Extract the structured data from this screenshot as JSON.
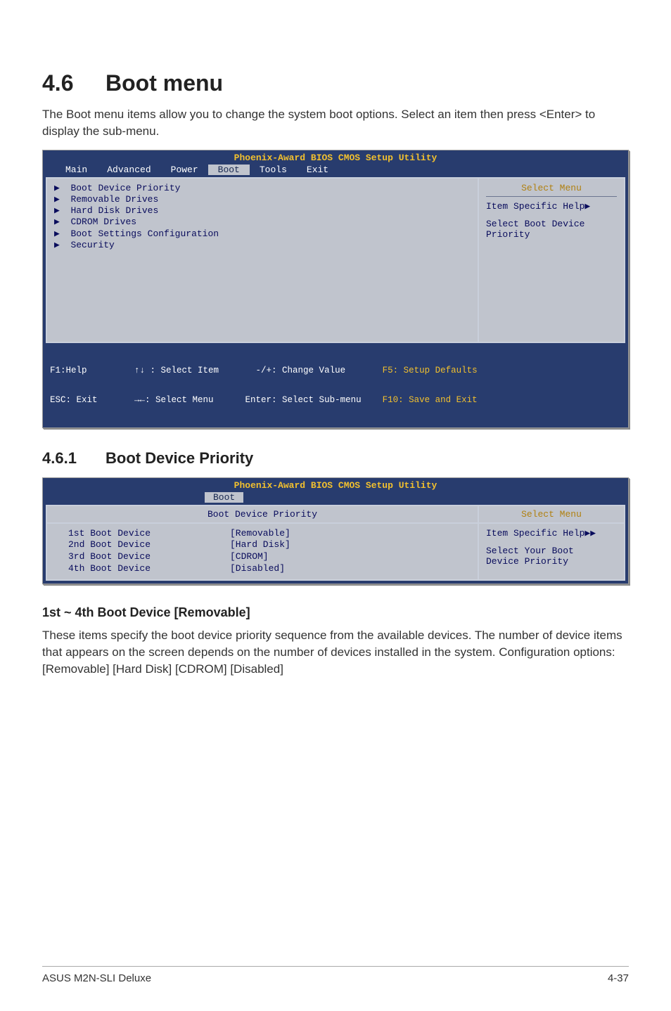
{
  "section": {
    "number": "4.6",
    "title": "Boot menu",
    "intro": "The Boot menu items allow you to change the system boot options. Select an item then press <Enter> to display the sub-menu."
  },
  "bios1": {
    "utility_title": "Phoenix-Award BIOS CMOS Setup Utility",
    "menus": {
      "main": "Main",
      "advanced": "Advanced",
      "power": "Power",
      "boot": "Boot",
      "tools": "Tools",
      "exit": "Exit"
    },
    "items": {
      "i1": "Boot Device Priority",
      "i2": "Removable Drives",
      "i3": "Hard Disk Drives",
      "i4": "CDROM Drives",
      "i5": "Boot Settings Configuration",
      "i6": "Security"
    },
    "help": {
      "select_menu": "Select Menu",
      "item_specific": "Item Specific Help▶",
      "desc1": "Select Boot Device",
      "desc2": "Priority"
    },
    "footer": {
      "f1": "F1:Help         ↑↓ : Select Item       -/+: Change Value",
      "f1r": "    F5: Setup Defaults",
      "esc": "ESC: Exit       →←: Select Menu      Enter: Select Sub-menu",
      "escr": "    F10: Save and Exit"
    }
  },
  "subsection": {
    "number": "4.6.1",
    "title": "Boot Device Priority"
  },
  "bios2": {
    "utility_title": "Phoenix-Award BIOS CMOS Setup Utility",
    "boot_tab": "Boot",
    "sub_title": "Boot Device Priority",
    "select_menu": "Select Menu",
    "rows": {
      "r1": {
        "label": "1st Boot Device",
        "value": "[Removable]"
      },
      "r2": {
        "label": "2nd Boot Device",
        "value": "[Hard Disk]"
      },
      "r3": {
        "label": "3rd Boot Device",
        "value": "[CDROM]"
      },
      "r4": {
        "label": "4th Boot Device",
        "value": "[Disabled]"
      }
    },
    "help": {
      "item_specific": "Item Specific Help▶▶",
      "desc1": "Select Your Boot",
      "desc2": "Device Priority"
    }
  },
  "setting": {
    "heading": "1st ~ 4th Boot Device [Removable]",
    "paragraph": "These items specify the boot device priority sequence from the available devices. The number of device items that appears on the screen depends on the number of devices installed in the system. Configuration options: [Removable] [Hard Disk] [CDROM] [Disabled]"
  },
  "footer": {
    "left": "ASUS M2N-SLI Deluxe",
    "right": "4-37"
  }
}
